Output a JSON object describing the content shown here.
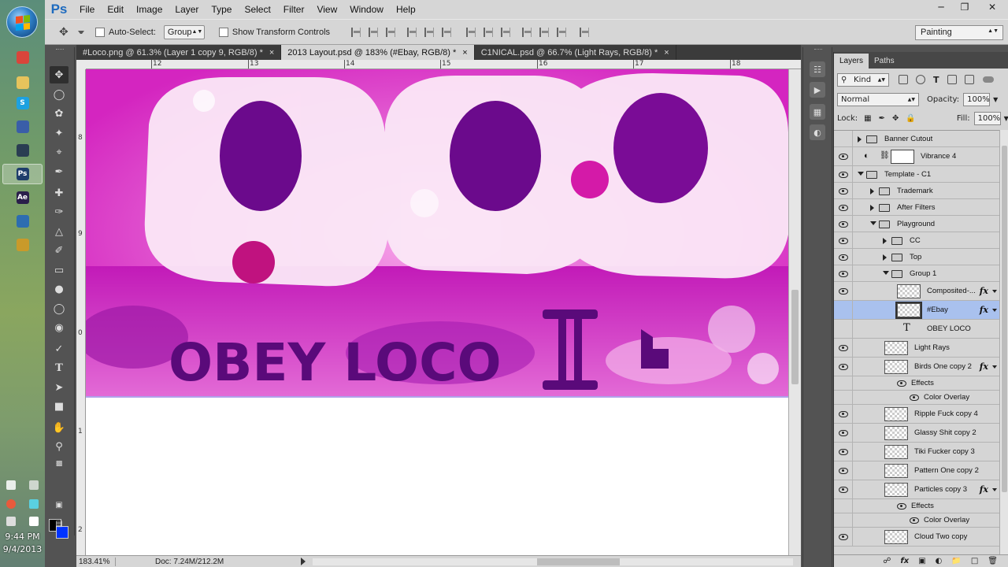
{
  "taskbar": {
    "clock_time": "9:44 PM",
    "clock_date": "9/4/2013",
    "apps": [
      {
        "name": "chrome-icon",
        "label": "",
        "color": "#d9453b"
      },
      {
        "name": "folder-icon",
        "label": "",
        "color": "#e6c35c"
      },
      {
        "name": "skype-icon",
        "label": "S",
        "color": "#1da1e0"
      },
      {
        "name": "media-icon",
        "label": "",
        "color": "#3a5ea8"
      },
      {
        "name": "steam-icon",
        "label": "",
        "color": "#2a3d52"
      },
      {
        "name": "photoshop-icon",
        "label": "Ps",
        "color": "#1e3d6b"
      },
      {
        "name": "after-effects-icon",
        "label": "Ae",
        "color": "#2a1f4a"
      },
      {
        "name": "globe-icon",
        "label": "",
        "color": "#2d6db0"
      },
      {
        "name": "mail-icon",
        "label": "",
        "color": "#c99a2a"
      }
    ]
  },
  "menubar": {
    "logo": "Ps",
    "items": [
      "File",
      "Edit",
      "Image",
      "Layer",
      "Type",
      "Select",
      "Filter",
      "View",
      "Window",
      "Help"
    ]
  },
  "options": {
    "auto_select_label": "Auto-Select:",
    "auto_select_value": "Group",
    "transform_label": "Show Transform Controls",
    "workspace": "Painting"
  },
  "tabs": [
    {
      "label": "#Loco.png @ 61.3% (Layer 1 copy 9, RGB/8) *",
      "active": false
    },
    {
      "label": "2013 Layout.psd @ 183% (#Ebay, RGB/8) *",
      "active": true
    },
    {
      "label": "C1NICAL.psd @ 66.7% (Light Rays, RGB/8) *",
      "active": false
    }
  ],
  "rulers": {
    "top": [
      "12",
      "13",
      "14",
      "15",
      "16",
      "17",
      "18"
    ],
    "left": [
      "8",
      "9",
      "0",
      "1",
      "2"
    ]
  },
  "canvas": {
    "art_text": "OBEY LOCO",
    "colors": {
      "magenta": "#c21ab8",
      "purple": "#5a0a7a",
      "pink": "#f07bd8",
      "white": "#ffffff"
    }
  },
  "status": {
    "zoom": "183.41%",
    "doc": "Doc: 7.24M/212.2M"
  },
  "layers_panel": {
    "tabs": [
      "Layers",
      "Paths"
    ],
    "filter_kind": "Kind",
    "blend_mode": "Normal",
    "opacity_label": "Opacity:",
    "opacity_value": "100%",
    "lock_label": "Lock:",
    "fill_label": "Fill:",
    "fill_value": "100%",
    "layers": [
      {
        "name": "Banner Cutout",
        "type": "group",
        "indent": 0,
        "visible": false,
        "open": false,
        "fx": false
      },
      {
        "name": "Vibrance 4",
        "type": "adjustment",
        "indent": 0,
        "visible": true,
        "fx": false
      },
      {
        "name": "Template - C1",
        "type": "group",
        "indent": 0,
        "visible": true,
        "open": true,
        "fx": false
      },
      {
        "name": "Trademark",
        "type": "group",
        "indent": 1,
        "visible": true,
        "open": false,
        "fx": false
      },
      {
        "name": "After Filters",
        "type": "group",
        "indent": 1,
        "visible": true,
        "open": false,
        "fx": false
      },
      {
        "name": "Playground",
        "type": "group",
        "indent": 1,
        "visible": true,
        "open": true,
        "fx": false
      },
      {
        "name": "CC",
        "type": "group",
        "indent": 2,
        "visible": true,
        "open": false,
        "fx": false
      },
      {
        "name": "Top",
        "type": "group",
        "indent": 2,
        "visible": true,
        "open": false,
        "fx": false
      },
      {
        "name": "Group 1",
        "type": "group",
        "indent": 2,
        "visible": true,
        "open": true,
        "fx": false
      },
      {
        "name": "Composited-...",
        "type": "pixel",
        "indent": 3,
        "visible": true,
        "fx": true
      },
      {
        "name": "#Ebay",
        "type": "pixel",
        "indent": 3,
        "visible": false,
        "fx": true,
        "selected": true
      },
      {
        "name": "OBEY LOCO",
        "type": "text",
        "indent": 3,
        "visible": false,
        "fx": false
      },
      {
        "name": "Light Rays",
        "type": "pixel",
        "indent": 2,
        "visible": true,
        "fx": false
      },
      {
        "name": "Birds One copy 2",
        "type": "pixel",
        "indent": 2,
        "visible": true,
        "fx": true
      },
      {
        "name": "Effects",
        "type": "effects",
        "indent": 2,
        "visible": true,
        "fx": false
      },
      {
        "name": "Color Overlay",
        "type": "effect",
        "indent": 2,
        "visible": true,
        "fx": false
      },
      {
        "name": "Ripple Fuck copy 4",
        "type": "pixel",
        "indent": 2,
        "visible": true,
        "fx": false
      },
      {
        "name": "Glassy Shit copy 2",
        "type": "pixel",
        "indent": 2,
        "visible": true,
        "fx": false
      },
      {
        "name": "Tiki Fucker copy 3",
        "type": "pixel",
        "indent": 2,
        "visible": true,
        "fx": false
      },
      {
        "name": "Pattern One copy 2",
        "type": "pixel",
        "indent": 2,
        "visible": true,
        "fx": false
      },
      {
        "name": "Particles copy 3",
        "type": "pixel",
        "indent": 2,
        "visible": true,
        "fx": true
      },
      {
        "name": "Effects",
        "type": "effects",
        "indent": 2,
        "visible": true,
        "fx": false
      },
      {
        "name": "Color Overlay",
        "type": "effect",
        "indent": 2,
        "visible": true,
        "fx": false
      },
      {
        "name": "Cloud Two copy",
        "type": "pixel",
        "indent": 2,
        "visible": true,
        "fx": false
      }
    ]
  }
}
